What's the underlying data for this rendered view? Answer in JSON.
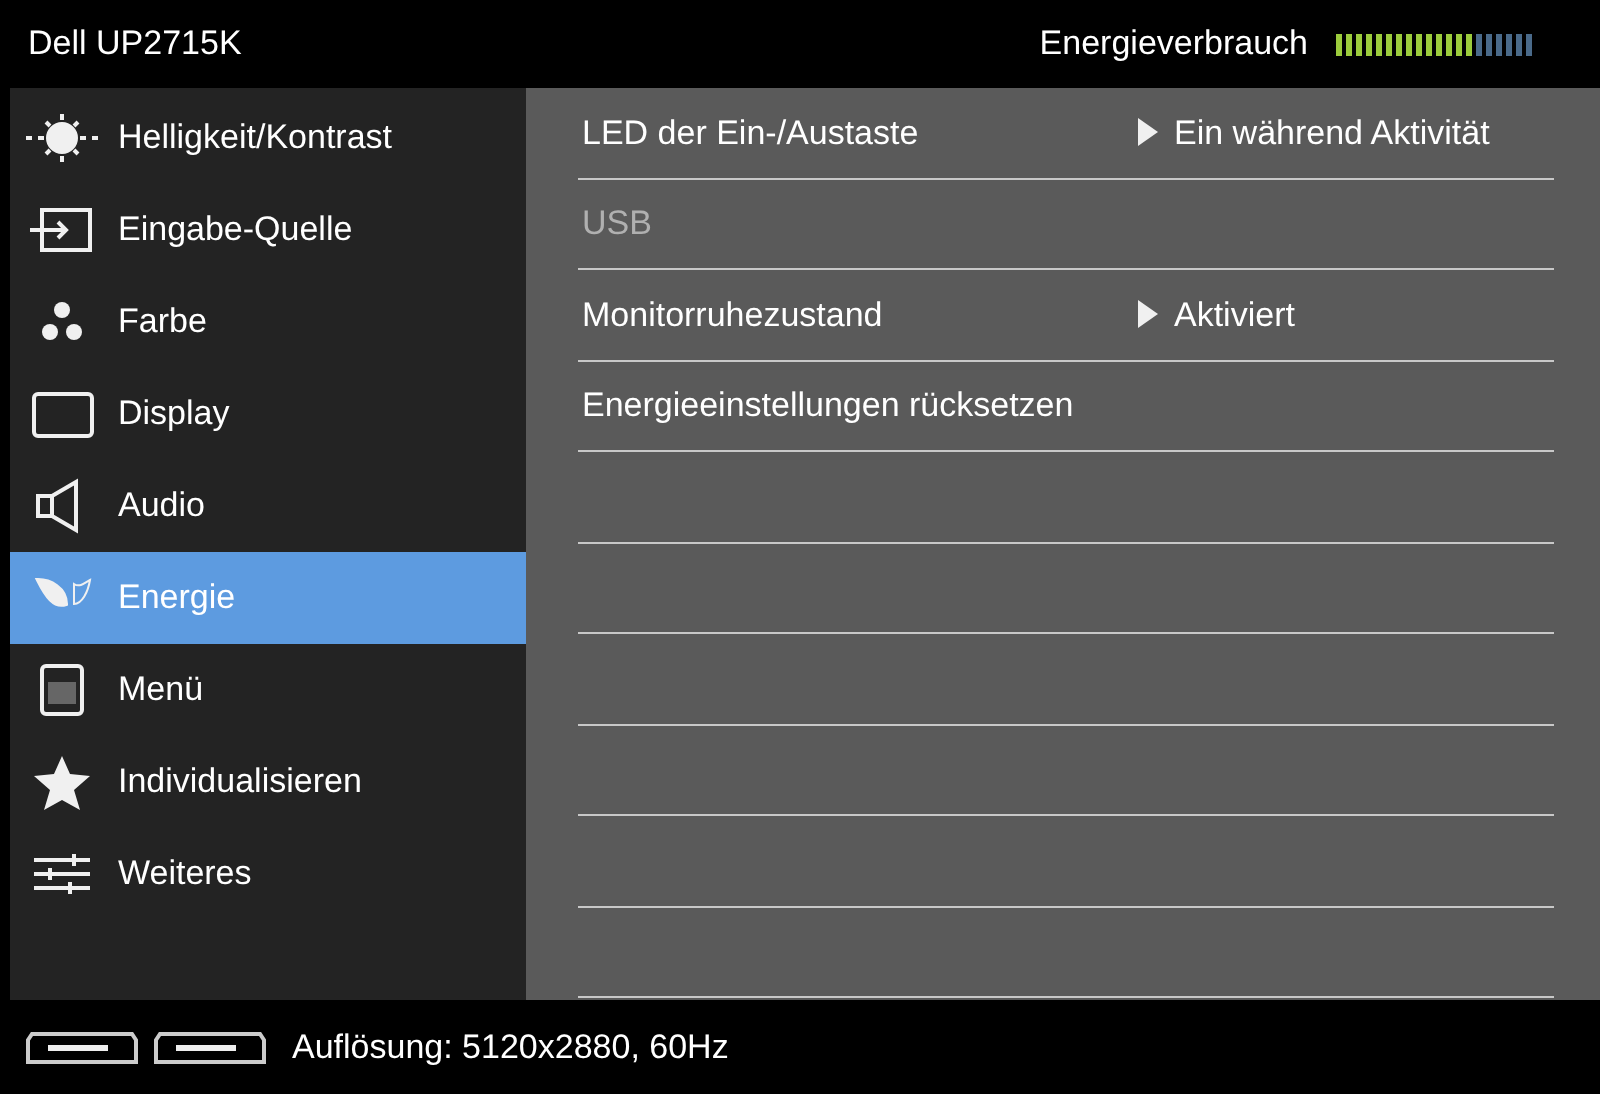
{
  "header": {
    "title": "Dell UP2715K",
    "meter_label": "Energieverbrauch",
    "meter": {
      "level": 0.7
    }
  },
  "sidebar": {
    "items": [
      {
        "kind": "brightness",
        "label": "Helligkeit/Kontrast",
        "selected": false
      },
      {
        "kind": "input",
        "label": "Eingabe-Quelle",
        "selected": false
      },
      {
        "kind": "color",
        "label": "Farbe",
        "selected": false
      },
      {
        "kind": "display",
        "label": "Display",
        "selected": false
      },
      {
        "kind": "audio",
        "label": "Audio",
        "selected": false
      },
      {
        "kind": "energy",
        "label": "Energie",
        "selected": true
      },
      {
        "kind": "menu",
        "label": "Menü",
        "selected": false
      },
      {
        "kind": "star",
        "label": "Individualisieren",
        "selected": false
      },
      {
        "kind": "sliders",
        "label": "Weiteres",
        "selected": false
      }
    ]
  },
  "settings": [
    {
      "label": "LED der Ein-/Austaste",
      "value": "Ein während Aktivität",
      "disabled": false
    },
    {
      "label": "USB",
      "disabled": true
    },
    {
      "label": "Monitorruhezustand",
      "value": "Aktiviert",
      "disabled": false
    },
    {
      "label": "Energieeinstellungen rücksetzen",
      "disabled": false
    }
  ],
  "status_bar": {
    "text": "Auflösung: 5120x2880, 60Hz"
  }
}
